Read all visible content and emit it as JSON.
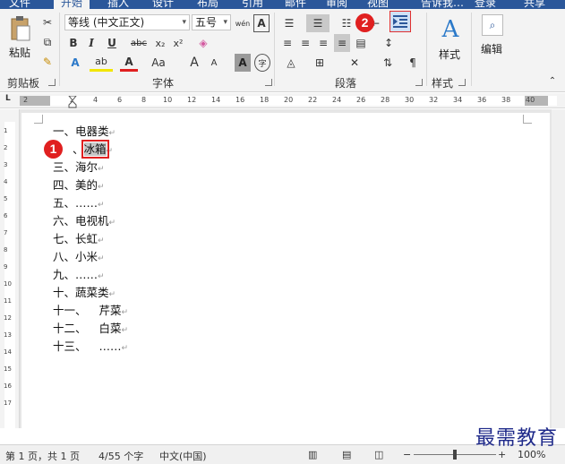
{
  "tabs": [
    "文件",
    "开始",
    "插入",
    "设计",
    "布局",
    "引用",
    "邮件",
    "审阅",
    "视图",
    "告诉我…",
    "登录",
    "共享"
  ],
  "ribbon": {
    "clipboard": {
      "paste": "粘贴",
      "label": "剪贴板"
    },
    "font": {
      "name": "等线 (中文正文)",
      "size": "五号",
      "phonetic": "wén",
      "border_char": "A",
      "bold": "B",
      "italic": "I",
      "underline": "U",
      "strike": "abc",
      "sub": "x₂",
      "sup": "x²",
      "effects": "A",
      "highlight": "ab",
      "color": "A",
      "case": "Aa",
      "grow": "A",
      "shrink": "A",
      "shade": "A",
      "enclose": "字",
      "label": "字体"
    },
    "paragraph": {
      "label": "段落"
    },
    "styles": {
      "button": "样式",
      "label": "样式"
    },
    "editing": {
      "button": "编辑"
    }
  },
  "badges": {
    "one": "1",
    "two": "2"
  },
  "ruler": {
    "h": [
      "2",
      "2",
      "4",
      "6",
      "8",
      "10",
      "12",
      "14",
      "16",
      "18",
      "20",
      "22",
      "24",
      "26",
      "28",
      "30",
      "32",
      "34",
      "36",
      "38",
      "40"
    ],
    "v": [
      "1",
      "2",
      "3",
      "4",
      "5",
      "6",
      "7",
      "8",
      "9",
      "10",
      "11",
      "12",
      "13",
      "14",
      "15",
      "16",
      "17"
    ]
  },
  "document": {
    "lines": [
      {
        "num": "一、",
        "text": "电器类"
      },
      {
        "num": "",
        "text": "冰箱"
      },
      {
        "num": "三、",
        "text": "海尔"
      },
      {
        "num": "四、",
        "text": "美的"
      },
      {
        "num": "五、",
        "text": "……"
      },
      {
        "num": "六、",
        "text": "电视机"
      },
      {
        "num": "七、",
        "text": "长虹"
      },
      {
        "num": "八、",
        "text": "小米"
      },
      {
        "num": "九、",
        "text": "……"
      },
      {
        "num": "十、",
        "text": "蔬菜类"
      },
      {
        "num": "十一、",
        "text": "芹菜"
      },
      {
        "num": "十二、",
        "text": "白菜"
      },
      {
        "num": "十三、",
        "text": "……"
      }
    ],
    "second_line_sep": "、",
    "para_mark": "↵"
  },
  "status": {
    "page": "第 1 页，共 1 页",
    "words": "4/55 个字",
    "lang": "中文(中国)",
    "zoom": "100%"
  },
  "watermark": "最需教育",
  "colors": {
    "accent": "#2b579a",
    "annotation": "#e02020"
  }
}
